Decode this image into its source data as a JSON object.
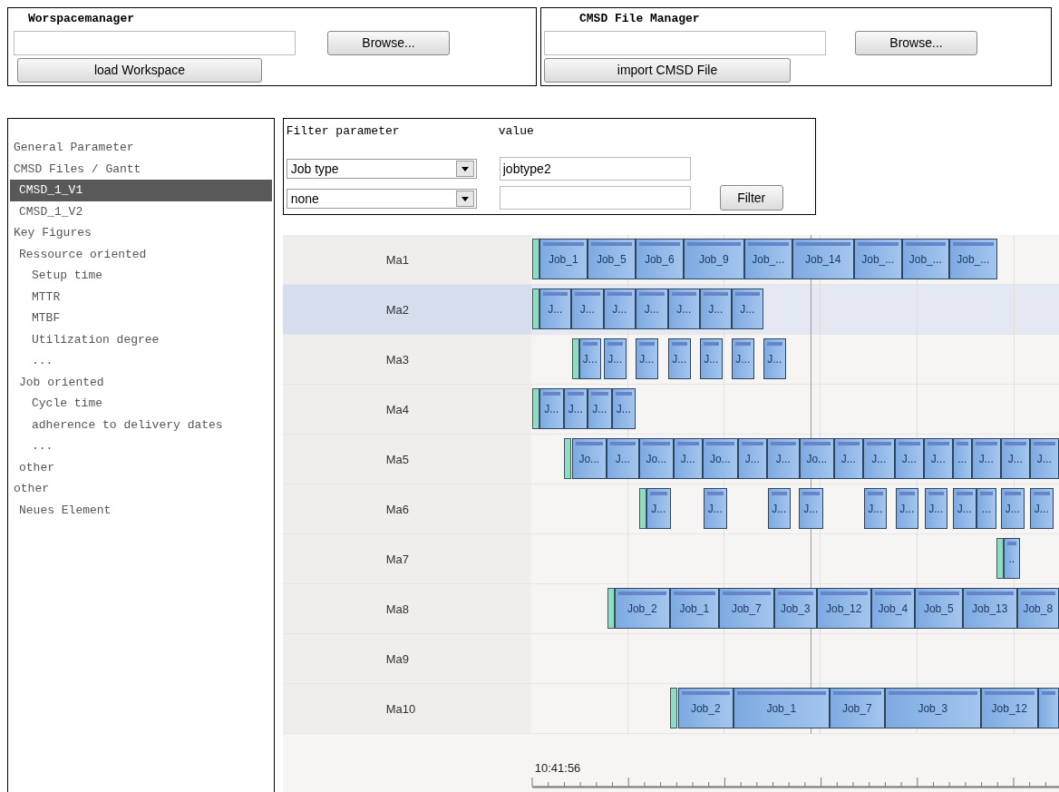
{
  "workspace_manager": {
    "title": "Worspacemanager",
    "browse_button": "Browse...",
    "load_button": "load Workspace"
  },
  "cmsd_file_manager": {
    "title": "CMSD File Manager",
    "browse_button": "Browse...",
    "import_button": "import CMSD File"
  },
  "sidebar": {
    "items": [
      {
        "label": "General Parameter",
        "selected": false
      },
      {
        "label": "CMSD Files / Gantt",
        "selected": false,
        "children": [
          {
            "label": "CMSD_1_V1",
            "selected": true
          },
          {
            "label": "CMSD_1_V2",
            "selected": false
          }
        ]
      },
      {
        "label": "Key Figures",
        "selected": false,
        "children": [
          {
            "label": "Ressource oriented",
            "selected": false,
            "children": [
              {
                "label": "Setup time",
                "selected": false
              },
              {
                "label": "MTTR",
                "selected": false
              },
              {
                "label": "MTBF",
                "selected": false
              },
              {
                "label": "Utilization degree",
                "selected": false
              },
              {
                "label": "...",
                "selected": false
              }
            ]
          },
          {
            "label": "Job oriented",
            "selected": false,
            "children": [
              {
                "label": "Cycle time",
                "selected": false
              },
              {
                "label": "adherence to delivery dates",
                "selected": false
              },
              {
                "label": "...",
                "selected": false
              }
            ]
          },
          {
            "label": "other",
            "selected": false
          }
        ]
      },
      {
        "label": "other",
        "selected": false,
        "children": [
          {
            "label": "Neues Element",
            "selected": false
          }
        ]
      }
    ]
  },
  "filter": {
    "parameter_heading": "Filter parameter",
    "value_heading": "value",
    "rows": [
      {
        "parameter": "Job type",
        "value": "jobtype2"
      },
      {
        "parameter": "none"
      }
    ],
    "filter_button": "Filter"
  },
  "gantt": {
    "rows": [
      {
        "label": "Ma1",
        "selected": false,
        "jobs": [
          {
            "label": "Job_1"
          },
          {
            "label": "Job_5"
          },
          {
            "label": "Job_6"
          },
          {
            "label": "Job_9"
          },
          {
            "label": "Job_..."
          },
          {
            "label": "Job_14"
          },
          {
            "label": "Job_..."
          },
          {
            "label": "Job_..."
          },
          {
            "label": "Job_..."
          }
        ]
      },
      {
        "label": "Ma2",
        "selected": true,
        "jobs": [
          {
            "label": "J..."
          },
          {
            "label": "J..."
          },
          {
            "label": "J..."
          },
          {
            "label": "J..."
          },
          {
            "label": "J..."
          },
          {
            "label": "J..."
          },
          {
            "label": "J..."
          }
        ]
      },
      {
        "label": "Ma3",
        "selected": false,
        "jobs": [
          {
            "label": "J..."
          },
          {
            "label": "J..."
          },
          {
            "label": "J..."
          },
          {
            "label": "J..."
          },
          {
            "label": "J..."
          },
          {
            "label": "J..."
          },
          {
            "label": "J..."
          }
        ]
      },
      {
        "label": "Ma4",
        "selected": false,
        "jobs": [
          {
            "label": "J..."
          },
          {
            "label": "J..."
          },
          {
            "label": "J..."
          },
          {
            "label": "J..."
          }
        ]
      },
      {
        "label": "Ma5",
        "selected": false,
        "jobs": [
          {
            "label": "Jo..."
          },
          {
            "label": "J..."
          },
          {
            "label": "Jo..."
          },
          {
            "label": "J..."
          },
          {
            "label": "Jo..."
          },
          {
            "label": "J..."
          },
          {
            "label": "J..."
          },
          {
            "label": "Jo..."
          },
          {
            "label": "J..."
          },
          {
            "label": "J..."
          },
          {
            "label": "J..."
          },
          {
            "label": "J..."
          },
          {
            "label": "..."
          },
          {
            "label": "J..."
          },
          {
            "label": "J..."
          },
          {
            "label": "J..."
          }
        ]
      },
      {
        "label": "Ma6",
        "selected": false,
        "jobs": [
          {
            "label": "J..."
          },
          {
            "label": "J..."
          },
          {
            "label": "J..."
          },
          {
            "label": "J..."
          },
          {
            "label": "J..."
          },
          {
            "label": "J..."
          },
          {
            "label": "J..."
          },
          {
            "label": "J..."
          },
          {
            "label": "..."
          },
          {
            "label": "J..."
          },
          {
            "label": "J..."
          }
        ]
      },
      {
        "label": "Ma7",
        "selected": false,
        "jobs": [
          {
            "label": ".."
          }
        ]
      },
      {
        "label": "Ma8",
        "selected": false,
        "jobs": [
          {
            "label": "Job_2"
          },
          {
            "label": "Job_1"
          },
          {
            "label": "Job_7"
          },
          {
            "label": "Job_3"
          },
          {
            "label": "Job_12"
          },
          {
            "label": "Job_4"
          },
          {
            "label": "Job_5"
          },
          {
            "label": "Job_13"
          },
          {
            "label": "Job_8"
          }
        ]
      },
      {
        "label": "Ma9",
        "selected": false,
        "jobs": []
      },
      {
        "label": "Ma10",
        "selected": false,
        "jobs": [
          {
            "label": "Job_2"
          },
          {
            "label": "Job_1"
          },
          {
            "label": "Job_7"
          },
          {
            "label": "Job_3"
          },
          {
            "label": "Job_12"
          },
          {
            "cut": true
          }
        ]
      }
    ],
    "time_label": "10:41:56"
  }
}
